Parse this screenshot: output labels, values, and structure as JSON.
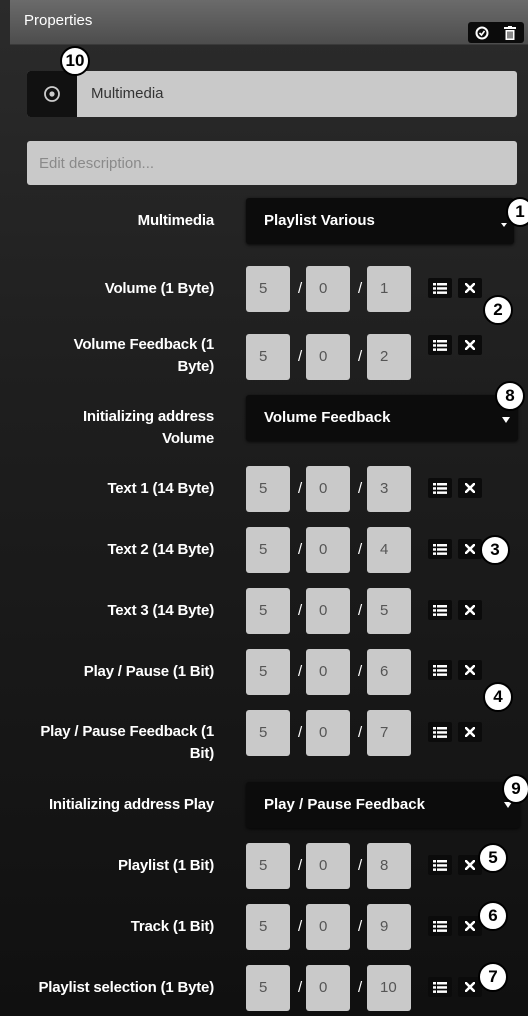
{
  "header": {
    "title": "Properties",
    "toggle_icon": "circle-check-icon",
    "delete_icon": "trash-icon"
  },
  "name_field": {
    "icon": "multimedia-disc-icon",
    "value": "Multimedia"
  },
  "description": {
    "placeholder": "Edit description..."
  },
  "rows": {
    "multimedia": {
      "label": "Multimedia",
      "selected": "Playlist Various"
    },
    "volume": {
      "label": "Volume (1 Byte)",
      "a": "5",
      "b": "0",
      "c": "1"
    },
    "volume_feedback": {
      "label1": "Volume Feedback (1",
      "label2": "Byte)",
      "a": "5",
      "b": "0",
      "c": "2"
    },
    "init_volume": {
      "label1": "Initializing address",
      "label2": "Volume",
      "selected": "Volume Feedback"
    },
    "text1": {
      "label": "Text 1 (14 Byte)",
      "a": "5",
      "b": "0",
      "c": "3"
    },
    "text2": {
      "label": "Text 2 (14 Byte)",
      "a": "5",
      "b": "0",
      "c": "4"
    },
    "text3": {
      "label": "Text 3 (14 Byte)",
      "a": "5",
      "b": "0",
      "c": "5"
    },
    "play_pause": {
      "label": "Play / Pause (1 Bit)",
      "a": "5",
      "b": "0",
      "c": "6"
    },
    "play_pause_feedback": {
      "label1": "Play / Pause Feedback (1",
      "label2": "Bit)",
      "a": "5",
      "b": "0",
      "c": "7"
    },
    "init_play": {
      "label": "Initializing address Play",
      "selected": "Play / Pause Feedback"
    },
    "playlist": {
      "label": "Playlist (1 Bit)",
      "a": "5",
      "b": "0",
      "c": "8"
    },
    "track": {
      "label": "Track (1 Bit)",
      "a": "5",
      "b": "0",
      "c": "9"
    },
    "playlist_selection": {
      "label": "Playlist selection (1 Byte)",
      "a": "5",
      "b": "0",
      "c": "10"
    }
  },
  "separator": "/",
  "callouts": [
    "10",
    "1",
    "2",
    "8",
    "3",
    "4",
    "9",
    "5",
    "6",
    "7"
  ]
}
